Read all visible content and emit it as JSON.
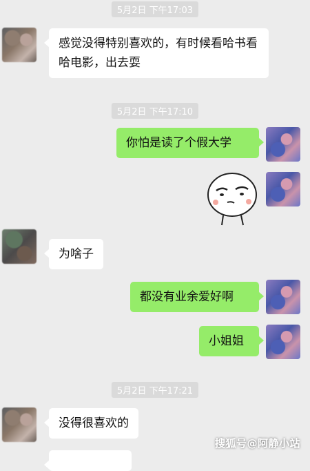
{
  "timestamps": [
    "5月2日 下午17:03",
    "5月2日 下午17:10",
    "5月2日 下午17:21"
  ],
  "messages": {
    "m1": "感觉没得特别喜欢的，有时候看哈书看哈电影，出去耍",
    "m2": "你怕是读了个假大学",
    "m4": "为啥子",
    "m5": "都没有业余爱好啊",
    "m6": "小姐姐",
    "m7": "没得很喜欢的"
  },
  "sticker": {
    "icon": "smug-face-sticker"
  },
  "watermark": "搜狐号@阿静小站",
  "colors": {
    "background": "#ececec",
    "incoming_bubble": "#ffffff",
    "outgoing_bubble": "#95ec69",
    "timestamp_bg": "#dadada"
  }
}
